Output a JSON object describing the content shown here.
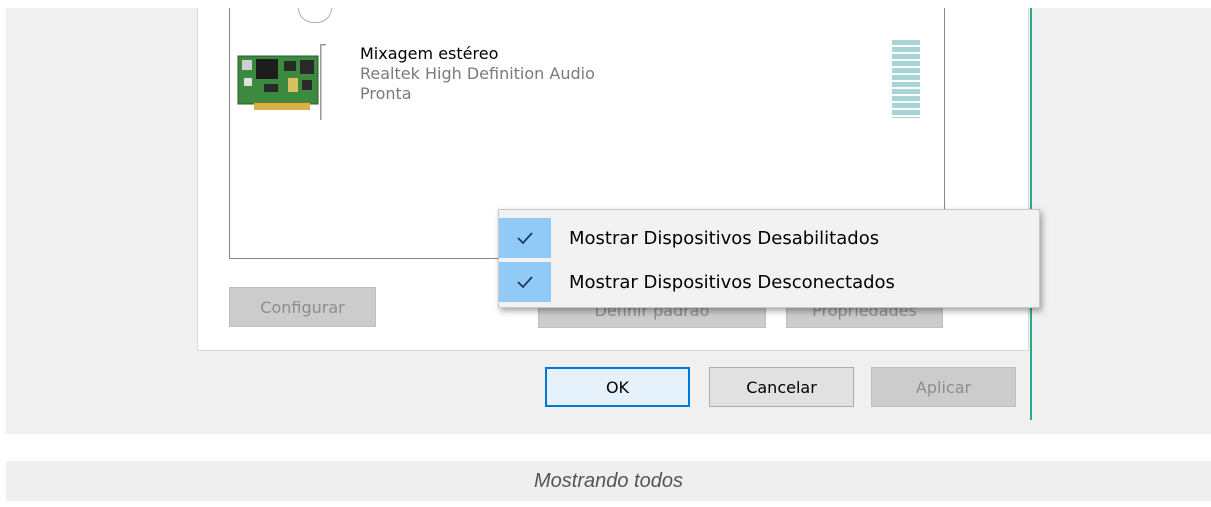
{
  "device": {
    "name": "Mixagem estéreo",
    "driver": "Realtek High Definition Audio",
    "status": "Pronta",
    "icon": "sound-card-icon",
    "level_meter_icon": "volume-level-meter"
  },
  "buttons": {
    "configure": "Configurar",
    "set_default": "Definir padrão",
    "properties": "Propriedades",
    "ok": "OK",
    "cancel": "Cancelar",
    "apply": "Aplicar"
  },
  "context_menu": {
    "items": [
      {
        "label": "Mostrar Dispositivos Desabilitados",
        "checked": true,
        "icon": "check-icon"
      },
      {
        "label": "Mostrar Dispositivos Desconectados",
        "checked": true,
        "icon": "check-icon"
      }
    ]
  },
  "caption": "Mostrando todos",
  "colors": {
    "menu_check_highlight": "#91c9f7",
    "ok_border": "#0078d7",
    "level_meter": "#a7d4d6",
    "accent_line": "#2aa88e"
  }
}
